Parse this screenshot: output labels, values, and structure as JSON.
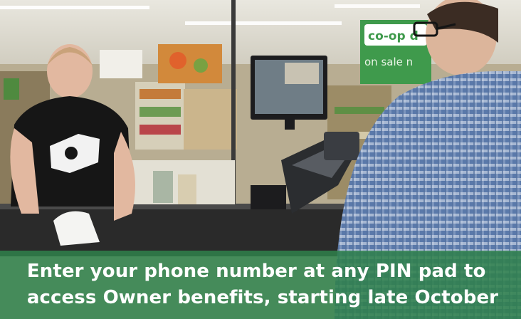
{
  "sign": {
    "store_name": "co-op d",
    "banner": "on sale n"
  },
  "caption": {
    "line1": "Enter your phone number at any PIN pad to",
    "line2": "access Owner benefits, starting late October"
  },
  "colors": {
    "caption_band": "#2e804a",
    "sign_green": "#3f9a4c",
    "employee_shirt": "#161616",
    "customer_shirt": "#5d7fae"
  }
}
